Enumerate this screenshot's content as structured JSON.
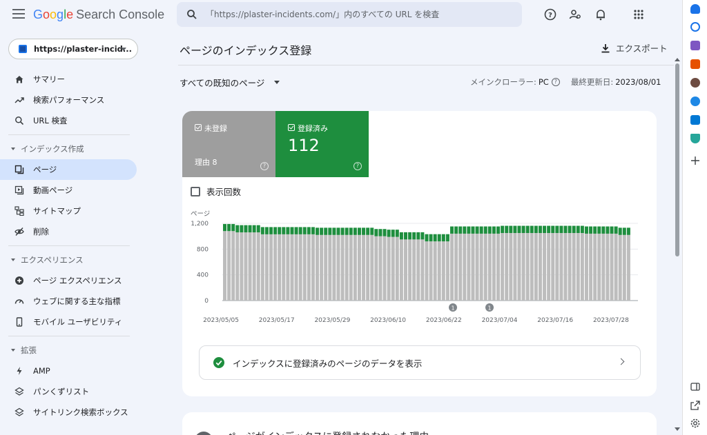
{
  "app": {
    "logo_google": "Google",
    "logo_product": "Search Console",
    "search_placeholder": "「https://plaster-incidents.com/」内のすべての URL を検査",
    "icons": [
      "menu-icon",
      "search-icon",
      "help-icon",
      "manage-accounts-icon",
      "notifications-icon",
      "apps-icon"
    ]
  },
  "sidebar": {
    "property": "https://plaster-incid...",
    "items_top": [
      {
        "label": "サマリー",
        "icon": "home-icon"
      },
      {
        "label": "検索パフォーマンス",
        "icon": "trending-up-icon"
      },
      {
        "label": "URL 検査",
        "icon": "search-icon"
      }
    ],
    "section_index": {
      "label": "インデックス作成",
      "items": [
        {
          "label": "ページ",
          "icon": "pages-icon",
          "active": true
        },
        {
          "label": "動画ページ",
          "icon": "video-page-icon"
        },
        {
          "label": "サイトマップ",
          "icon": "sitemap-icon"
        },
        {
          "label": "削除",
          "icon": "removal-icon"
        }
      ]
    },
    "section_experience": {
      "label": "エクスペリエンス",
      "items": [
        {
          "label": "ページ エクスペリエンス",
          "icon": "page-experience-icon"
        },
        {
          "label": "ウェブに関する主な指標",
          "icon": "speed-icon"
        },
        {
          "label": "モバイル ユーザビリティ",
          "icon": "mobile-icon"
        }
      ]
    },
    "section_enhancements": {
      "label": "拡張",
      "items": [
        {
          "label": "AMP",
          "icon": "amp-icon"
        },
        {
          "label": "パンくずリスト",
          "icon": "layers-icon"
        },
        {
          "label": "サイトリンク検索ボックス",
          "icon": "layers-icon"
        }
      ]
    }
  },
  "main": {
    "title": "ページのインデックス登録",
    "export_label": "エクスポート",
    "filter_label": "すべての既知のページ",
    "crawler_label": "メインクローラー:",
    "crawler_value": "PC",
    "updated_label": "最終更新日:",
    "updated_value": "2023/08/01",
    "tile_not_indexed": {
      "label": "未登録",
      "sub": "理由 8"
    },
    "tile_indexed": {
      "label": "登録済み",
      "value": "112"
    },
    "impressions_label": "表示回数",
    "view_indexed_link": "インデックスに登録済みのページのデータを表示",
    "next_card_title": "ページがインデックスに登録されなかった理由"
  },
  "colors": {
    "indexed": "#1e8e3e",
    "not_indexed": "#bdbdbd",
    "tile_grey": "#9e9e9e",
    "active_nav": "#d3e3fd"
  },
  "chart_data": {
    "type": "bar",
    "stacked": true,
    "ylabel": "ページ",
    "ylim": [
      0,
      1200
    ],
    "yticks": [
      "0",
      "400",
      "800",
      "1,200"
    ],
    "xtick_labels": [
      "2023/05/05",
      "2023/05/17",
      "2023/05/29",
      "2023/06/10",
      "2023/06/22",
      "2023/07/04",
      "2023/07/16",
      "2023/07/28"
    ],
    "annotations": [
      {
        "label": "1",
        "date": "2023/06/21"
      },
      {
        "label": "1",
        "date": "2023/06/29"
      }
    ],
    "series": [
      {
        "name": "未登録",
        "values": [
          1080,
          1080,
          1080,
          1060,
          1060,
          1060,
          1060,
          1060,
          1060,
          1030,
          1030,
          1030,
          1030,
          1030,
          1030,
          1030,
          1030,
          1030,
          1030,
          1030,
          1030,
          1030,
          1020,
          1020,
          1020,
          1020,
          1020,
          1020,
          1020,
          1020,
          1020,
          1020,
          1020,
          1020,
          1020,
          1020,
          1000,
          1000,
          1000,
          990,
          990,
          990,
          950,
          950,
          950,
          950,
          950,
          950,
          920,
          920,
          920,
          920,
          920,
          920,
          1040,
          1040,
          1040,
          1040,
          1040,
          1040,
          1040,
          1040,
          1040,
          1040,
          1040,
          1040,
          1050,
          1050,
          1050,
          1050,
          1050,
          1050,
          1050,
          1050,
          1050,
          1050,
          1050,
          1050,
          1050,
          1050,
          1050,
          1050,
          1050,
          1050,
          1050,
          1050,
          1040,
          1040,
          1040,
          1040,
          1040,
          1040,
          1040,
          1040,
          1020,
          1020,
          1020
        ]
      },
      {
        "name": "登録済み",
        "values": [
          110,
          110,
          110,
          112,
          112,
          112,
          112,
          112,
          112,
          112,
          112,
          112,
          112,
          112,
          112,
          112,
          112,
          112,
          112,
          112,
          112,
          112,
          112,
          112,
          112,
          112,
          112,
          112,
          112,
          112,
          112,
          112,
          112,
          112,
          112,
          112,
          112,
          112,
          112,
          112,
          112,
          112,
          112,
          112,
          112,
          112,
          112,
          112,
          112,
          112,
          112,
          112,
          112,
          112,
          112,
          112,
          112,
          112,
          112,
          112,
          112,
          112,
          112,
          112,
          112,
          112,
          112,
          112,
          112,
          112,
          112,
          112,
          112,
          112,
          112,
          112,
          112,
          112,
          112,
          112,
          112,
          112,
          112,
          112,
          112,
          112,
          112,
          112,
          112,
          112,
          112,
          112,
          112,
          112,
          112,
          112,
          112
        ]
      }
    ]
  }
}
